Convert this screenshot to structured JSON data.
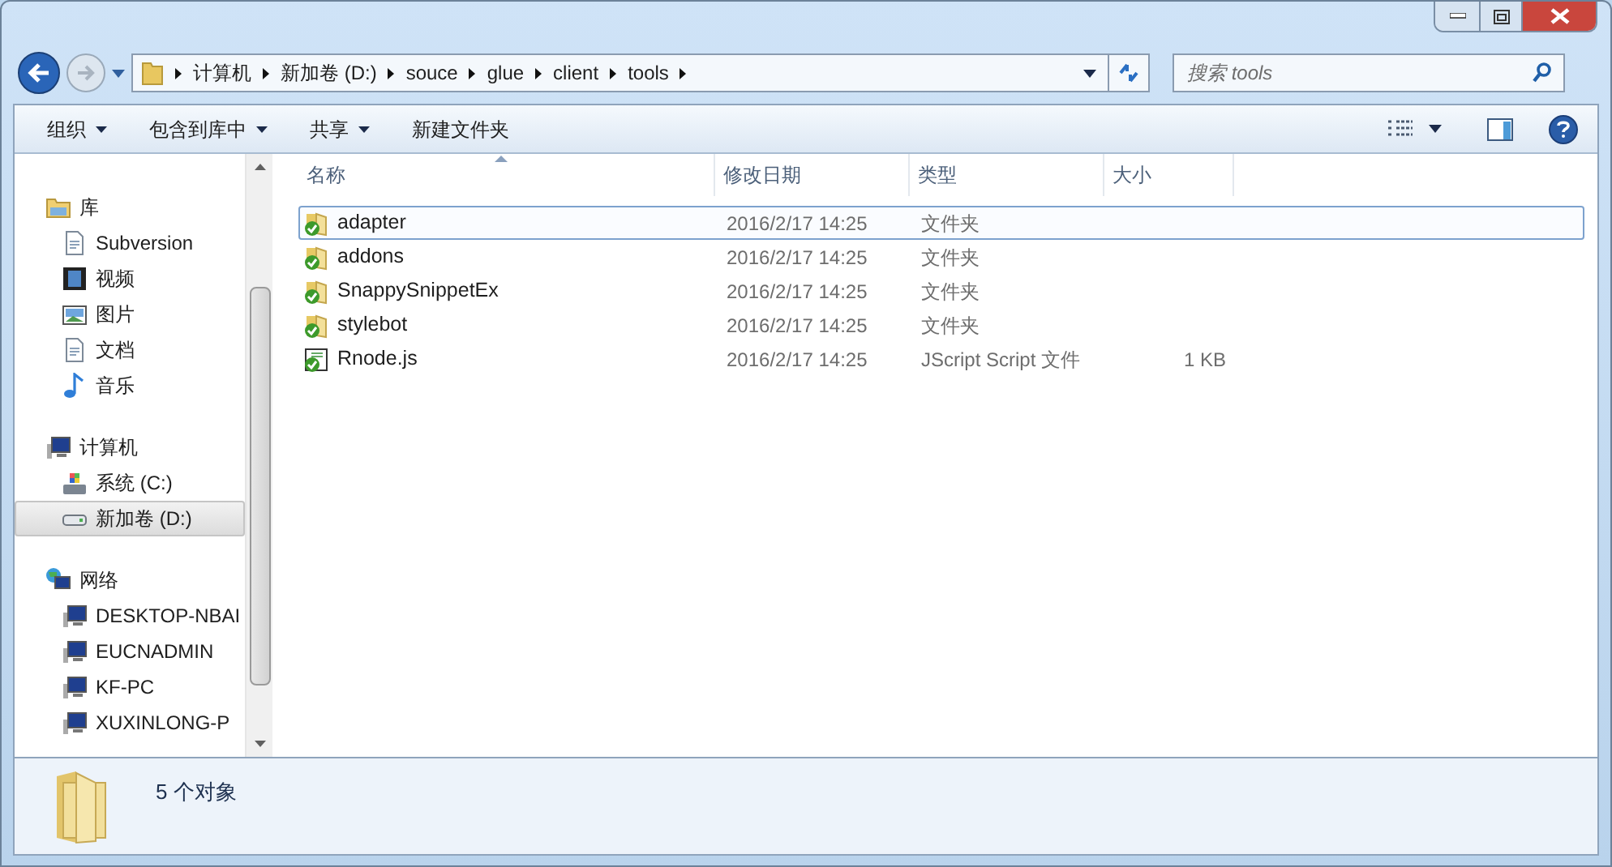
{
  "address_bar": {
    "path": [
      "计算机",
      "新加卷 (D:)",
      "souce",
      "glue",
      "client",
      "tools"
    ]
  },
  "search": {
    "placeholder": "搜索 tools"
  },
  "toolbar": {
    "buttons": [
      {
        "label": "组织",
        "dropdown": true
      },
      {
        "label": "包含到库中",
        "dropdown": true
      },
      {
        "label": "共享",
        "dropdown": true
      },
      {
        "label": "新建文件夹",
        "dropdown": false
      }
    ]
  },
  "sidebar": {
    "groups": [
      {
        "label": "库",
        "kind": "library",
        "selected": false,
        "children": [
          {
            "label": "Subversion",
            "kind": "document",
            "selected": false
          },
          {
            "label": "视频",
            "kind": "video",
            "selected": false
          },
          {
            "label": "图片",
            "kind": "picture",
            "selected": false
          },
          {
            "label": "文档",
            "kind": "document",
            "selected": false
          },
          {
            "label": "音乐",
            "kind": "music",
            "selected": false
          }
        ]
      },
      {
        "label": "计算机",
        "kind": "computer",
        "selected": false,
        "children": [
          {
            "label": "系统 (C:)",
            "kind": "system-drive",
            "selected": false
          },
          {
            "label": "新加卷 (D:)",
            "kind": "drive",
            "selected": true
          }
        ]
      },
      {
        "label": "网络",
        "kind": "network",
        "selected": false,
        "children": [
          {
            "label": "DESKTOP-NBAI",
            "kind": "computer",
            "selected": false
          },
          {
            "label": "EUCNADMIN",
            "kind": "computer",
            "selected": false
          },
          {
            "label": "KF-PC",
            "kind": "computer",
            "selected": false
          },
          {
            "label": "XUXINLONG-P",
            "kind": "computer",
            "selected": false
          }
        ]
      }
    ]
  },
  "table": {
    "columns": [
      "名称",
      "修改日期",
      "类型",
      "大小"
    ],
    "rows": [
      {
        "name": "adapter",
        "kind": "folder",
        "modified": "2016/2/17 14:25",
        "type": "文件夹",
        "size": "",
        "selected": true
      },
      {
        "name": "addons",
        "kind": "folder",
        "modified": "2016/2/17 14:25",
        "type": "文件夹",
        "size": "",
        "selected": false
      },
      {
        "name": "SnappySnippetEx",
        "kind": "folder",
        "modified": "2016/2/17 14:25",
        "type": "文件夹",
        "size": "",
        "selected": false
      },
      {
        "name": "stylebot",
        "kind": "folder",
        "modified": "2016/2/17 14:25",
        "type": "文件夹",
        "size": "",
        "selected": false
      },
      {
        "name": "Rnode.js",
        "kind": "script",
        "modified": "2016/2/17 14:25",
        "type": "JScript Script 文件",
        "size": "1 KB",
        "selected": false
      }
    ]
  },
  "status_bar": {
    "text": "5 个对象"
  }
}
